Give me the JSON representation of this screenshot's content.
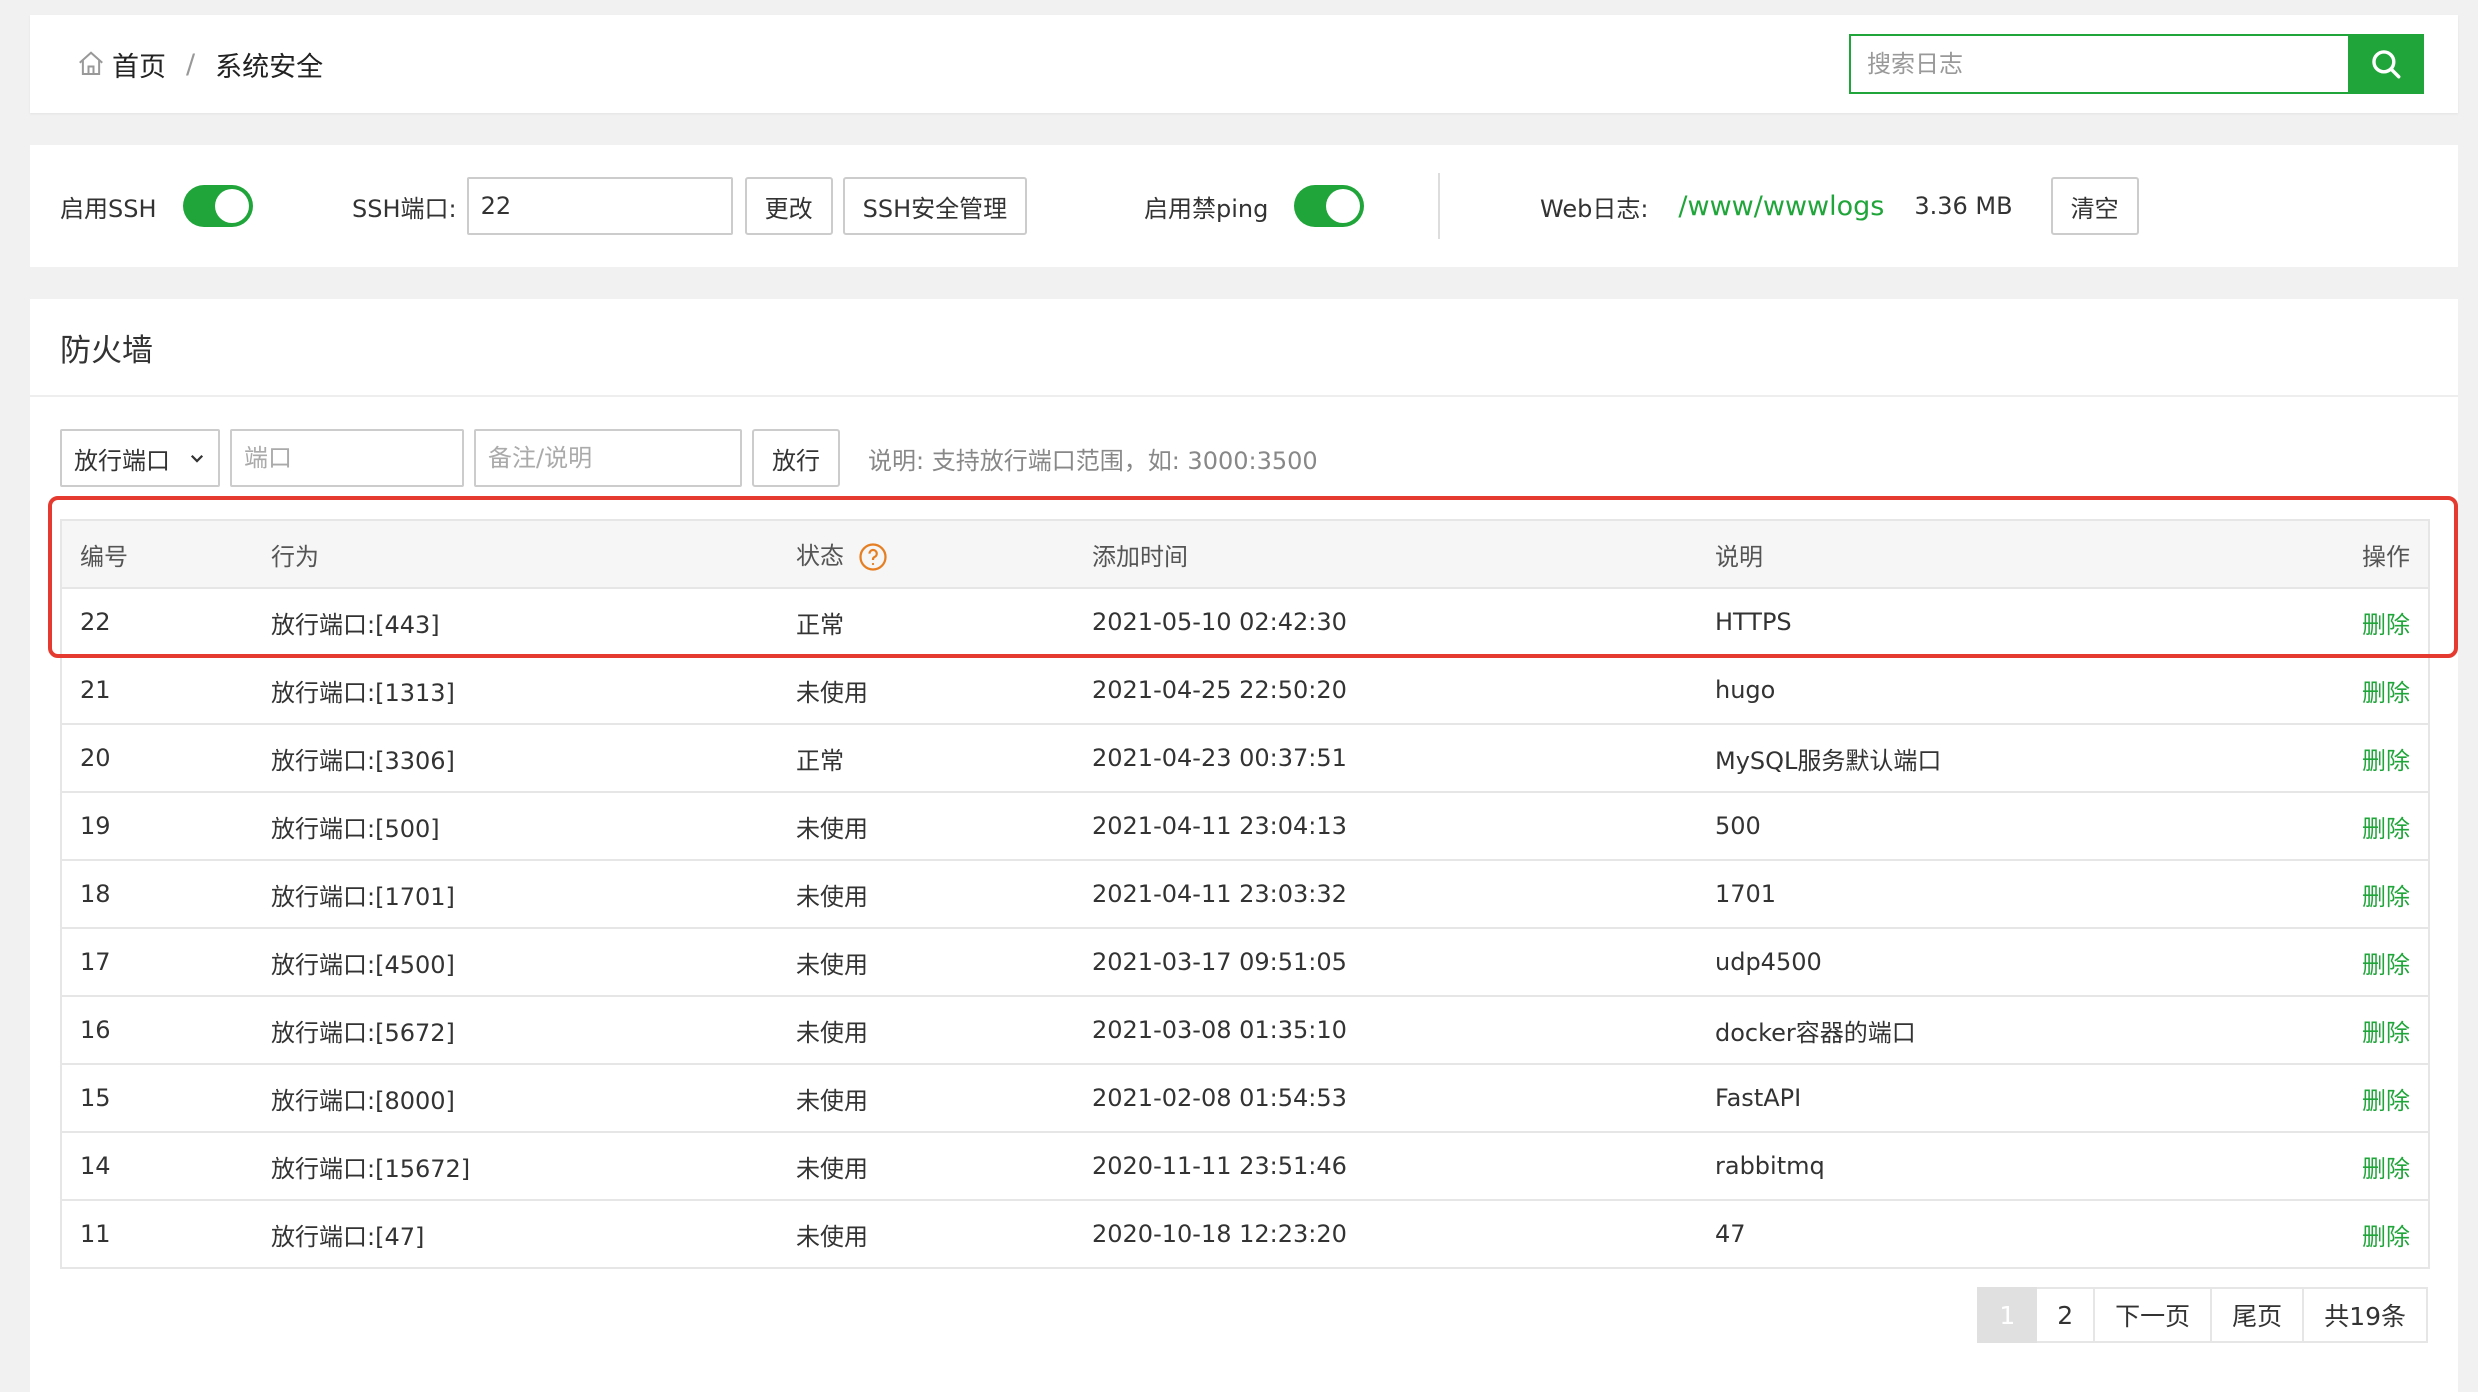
{
  "breadcrumb": {
    "home": "首页",
    "separator": "/",
    "current": "系统安全"
  },
  "search": {
    "placeholder": "搜索日志"
  },
  "settings": {
    "ssh_label": "启用SSH",
    "ssh_enabled": true,
    "ssh_port_label": "SSH端口:",
    "ssh_port_value": "22",
    "change_button": "更改",
    "ssh_manage_button": "SSH安全管理",
    "ping_label": "启用禁ping",
    "ping_enabled": true,
    "weblog_label": "Web日志:",
    "weblog_path": "/www/wwwlogs",
    "weblog_size": "3.36 MB",
    "clear_button": "清空"
  },
  "firewall": {
    "title": "防火墙",
    "select_value": "放行端口",
    "port_placeholder": "端口",
    "note_placeholder": "备注/说明",
    "allow_button": "放行",
    "hint": "说明: 支持放行端口范围，如: 3000:3500",
    "columns": [
      "编号",
      "行为",
      "状态",
      "添加时间",
      "说明",
      "操作"
    ],
    "rows": [
      {
        "id": "22",
        "action": "放行端口:[443]",
        "status": "正常",
        "time": "2021-05-10 02:42:30",
        "note": "HTTPS",
        "op": "删除"
      },
      {
        "id": "21",
        "action": "放行端口:[1313]",
        "status": "未使用",
        "time": "2021-04-25 22:50:20",
        "note": "hugo",
        "op": "删除"
      },
      {
        "id": "20",
        "action": "放行端口:[3306]",
        "status": "正常",
        "time": "2021-04-23 00:37:51",
        "note": "MySQL服务默认端口",
        "op": "删除"
      },
      {
        "id": "19",
        "action": "放行端口:[500]",
        "status": "未使用",
        "time": "2021-04-11 23:04:13",
        "note": "500",
        "op": "删除"
      },
      {
        "id": "18",
        "action": "放行端口:[1701]",
        "status": "未使用",
        "time": "2021-04-11 23:03:32",
        "note": "1701",
        "op": "删除"
      },
      {
        "id": "17",
        "action": "放行端口:[4500]",
        "status": "未使用",
        "time": "2021-03-17 09:51:05",
        "note": "udp4500",
        "op": "删除"
      },
      {
        "id": "16",
        "action": "放行端口:[5672]",
        "status": "未使用",
        "time": "2021-03-08 01:35:10",
        "note": "docker容器的端口",
        "op": "删除"
      },
      {
        "id": "15",
        "action": "放行端口:[8000]",
        "status": "未使用",
        "time": "2021-02-08 01:54:53",
        "note": "FastAPI",
        "op": "删除"
      },
      {
        "id": "14",
        "action": "放行端口:[15672]",
        "status": "未使用",
        "time": "2020-11-11 23:51:46",
        "note": "rabbitmq",
        "op": "删除"
      },
      {
        "id": "11",
        "action": "放行端口:[47]",
        "status": "未使用",
        "time": "2020-10-18 12:23:20",
        "note": "47",
        "op": "删除"
      }
    ]
  },
  "pagination": {
    "current": "1",
    "page2": "2",
    "next": "下一页",
    "last": "尾页",
    "total": "共19条"
  },
  "colors": {
    "accent": "#20a53a",
    "highlight": "#e53a2f",
    "help": "#e67e22"
  }
}
